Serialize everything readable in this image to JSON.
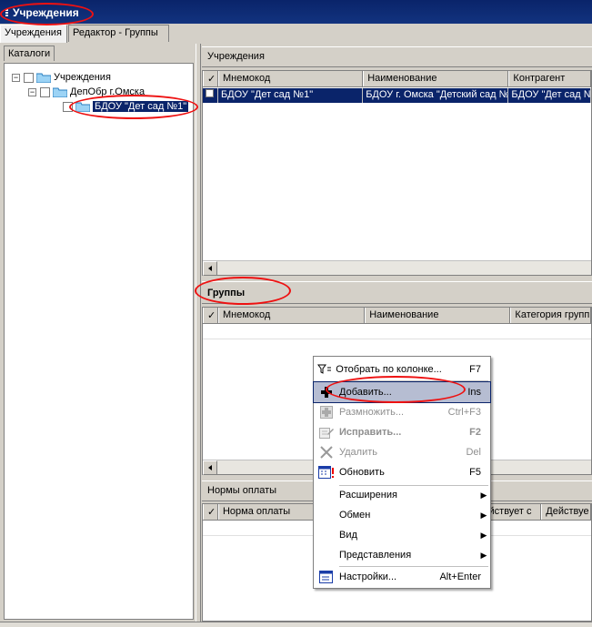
{
  "window": {
    "title": "Учреждения"
  },
  "top_tabs": [
    {
      "label": "Учреждения"
    },
    {
      "label": "Редактор - Группы"
    }
  ],
  "left": {
    "tab_label": "Каталоги",
    "tree": [
      {
        "label": "Учреждения"
      },
      {
        "label": "ДепОбр г.Омска"
      },
      {
        "label": "БДОУ \"Дет сад №1\""
      }
    ]
  },
  "institutions": {
    "title": "Учреждения",
    "columns": [
      "✓",
      "Мнемокод",
      "Наименование",
      "Контрагент"
    ],
    "rows": [
      {
        "mnemocode": "БДОУ \"Дет сад №1\"",
        "name": "БДОУ г. Омска \"Детский сад №",
        "counterparty": "БДОУ \"Дет сад №"
      }
    ]
  },
  "groups": {
    "title": "Группы",
    "columns": [
      "✓",
      "Мнемокод",
      "Наименование",
      "Категория групп"
    ]
  },
  "payments": {
    "title": "Нормы оплаты",
    "columns": [
      "✓",
      "Норма оплаты",
      "йствует с",
      "Действуе"
    ]
  },
  "context_menu": {
    "items": [
      {
        "label": "Отобрать по колонке...",
        "shortcut": "F7",
        "icon": "filter-icon"
      },
      {
        "label": "Добавить...",
        "shortcut": "Ins",
        "icon": "plus-icon"
      },
      {
        "label": "Размножить...",
        "shortcut": "Ctrl+F3",
        "icon": "duplicate-icon"
      },
      {
        "label": "Исправить...",
        "shortcut": "F2",
        "icon": "edit-icon"
      },
      {
        "label": "Удалить",
        "shortcut": "Del",
        "icon": "delete-icon"
      },
      {
        "label": "Обновить",
        "shortcut": "F5",
        "icon": "refresh-icon"
      },
      {
        "label": "Расширения",
        "icon": ""
      },
      {
        "label": "Обмен",
        "icon": ""
      },
      {
        "label": "Вид",
        "icon": ""
      },
      {
        "label": "Представления",
        "icon": ""
      },
      {
        "label": "Настройки...",
        "shortcut": "Alt+Enter",
        "icon": "settings-icon"
      }
    ],
    "submenu_arrow": "▶"
  },
  "colors": {
    "titlebar": "#0a246a",
    "selection": "#0a246a",
    "annotation": "#e11111"
  }
}
